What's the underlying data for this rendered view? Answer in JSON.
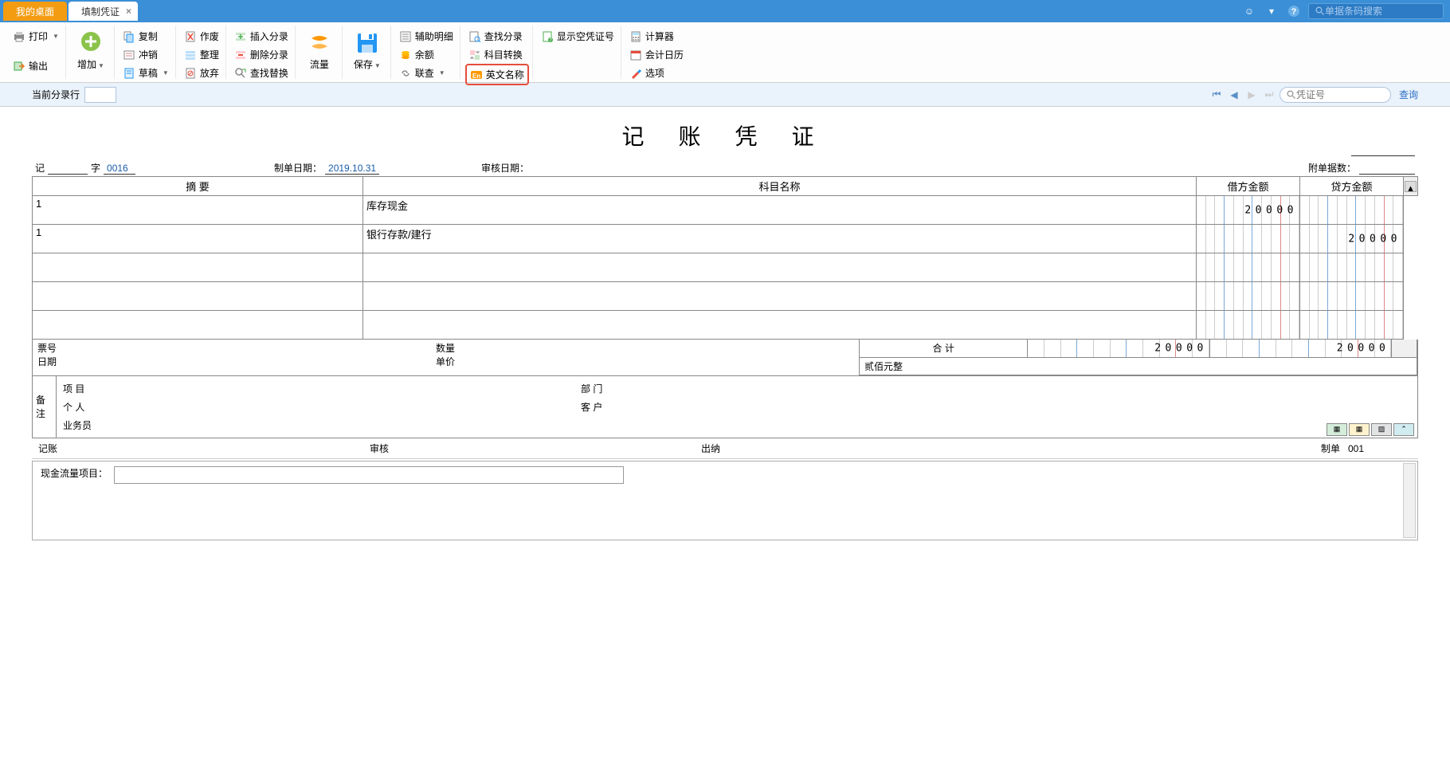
{
  "tabs": {
    "desktop": "我的桌面",
    "voucher": "填制凭证"
  },
  "topbar": {
    "search_placeholder": "单据条码搜索"
  },
  "ribbon": {
    "print": "打印",
    "output": "输出",
    "add": "增加",
    "copy": "复制",
    "offset": "冲销",
    "draft": "草稿",
    "void": "作废",
    "tidy": "整理",
    "abandon": "放弃",
    "insert_entry": "插入分录",
    "delete_entry": "删除分录",
    "find_replace": "查找替换",
    "flow": "流量",
    "save": "保存",
    "aux_detail": "辅助明细",
    "balance": "余额",
    "link_check": "联查",
    "find_entry": "查找分录",
    "acct_convert": "科目转换",
    "english_name": "英文名称",
    "show_empty": "显示空凭证号",
    "calculator": "计算器",
    "calendar": "会计日历",
    "options": "选项"
  },
  "subheader": {
    "current_row": "当前分录行",
    "voucher_placeholder": "凭证号",
    "query": "查询"
  },
  "voucher": {
    "title": "记 账 凭 证",
    "type_prefix": "记",
    "type_suffix": "字",
    "number": "0016",
    "make_date_label": "制单日期：",
    "make_date": "2019.10.31",
    "audit_date_label": "审核日期：",
    "attach_label": "附单据数：",
    "headers": {
      "summary": "摘 要",
      "account": "科目名称",
      "debit": "借方金额",
      "credit": "贷方金额"
    },
    "rows": [
      {
        "summary": "1",
        "account": "库存现金",
        "debit": "20000",
        "credit": ""
      },
      {
        "summary": "1",
        "account": "银行存款/建行",
        "debit": "",
        "credit": "20000"
      },
      {
        "summary": "",
        "account": "",
        "debit": "",
        "credit": ""
      },
      {
        "summary": "",
        "account": "",
        "debit": "",
        "credit": ""
      },
      {
        "summary": "",
        "account": "",
        "debit": "",
        "credit": ""
      }
    ],
    "detail": {
      "ticket": "票号",
      "date": "日期",
      "qty": "数量",
      "price": "单价"
    },
    "total_label": "合 计",
    "total_debit": "20000",
    "total_credit": "20000",
    "total_text": "贰佰元整",
    "remark": {
      "label": "备注",
      "project": "项 目",
      "dept": "部 门",
      "person": "个 人",
      "customer": "客 户",
      "sales": "业务员"
    },
    "footer": {
      "bookkeep": "记账",
      "audit": "审核",
      "cashier": "出纳",
      "maker": "制单",
      "maker_val": "001"
    },
    "cashflow_label": "现金流量项目："
  }
}
